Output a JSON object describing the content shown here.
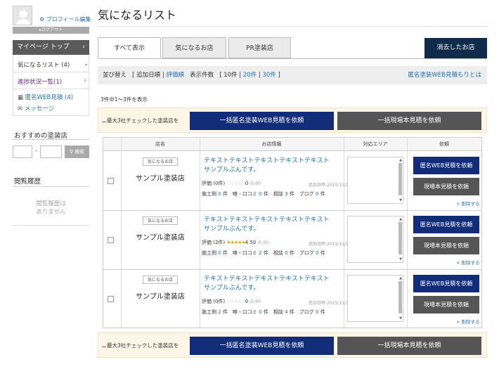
{
  "sidebar": {
    "profile_edit": "プロフィール編集",
    "logout": "ログアウト",
    "mypage_top": "マイページ トップ",
    "chevron": "›",
    "favorites": "気になるリスト (4)",
    "progress": "進捗状況一覧(1)",
    "anon_quote": "匿名WEB見積 (4)",
    "message": "メッセージ",
    "recommend_title": "おすすめの塗装店",
    "search_sep": "-",
    "search_button": "検索",
    "history_title": "閲覧履歴",
    "history_empty_1": "閲覧履歴は",
    "history_empty_2": "ありません"
  },
  "main": {
    "title": "気になるリスト",
    "tabs": [
      {
        "label": "すべて表示"
      },
      {
        "label": "気になるお店"
      },
      {
        "label": "PR塗装店"
      }
    ],
    "deleted_button": "消去したお店",
    "sort": {
      "label": "並び替え",
      "open": "[",
      "close": "]",
      "added": "追加日順",
      "sep": "|",
      "rating": "評価順",
      "count_label": "表示件数",
      "c10": "10件",
      "c20": "20件",
      "c30": "30件",
      "what_is": "匿名塗装WEB見積もりとは"
    },
    "count_text": "3件中1～3件を表示",
    "bulk": {
      "label": "最大3社チェックした塗装店を",
      "anon_button": "一括匿名塗装WEB見積を依頼",
      "site_button": "一括現場本見積を依頼"
    },
    "table": {
      "headers": [
        "店名",
        "お店情報",
        "対応エリア",
        "依頼"
      ],
      "rows": [
        {
          "badge": "気になるお店",
          "shop": "サンプル塗装店",
          "desc1": "テキストテキストテキストテキストテキスト",
          "desc2": "サンプルぶんです。",
          "rating_label": "評価",
          "rating_count": "(0件)",
          "stars": "☆☆☆☆☆",
          "score": "0",
          "score_max": "/5.00",
          "date": "追加日時:2015/11/16",
          "cases_label": "施工例",
          "cases": "0",
          "reviews_label": "件　噂・口コミ",
          "reviews": "0",
          "consult_label": "件　相談",
          "consult": "3",
          "blog_label": "件　ブログ",
          "blog": "0",
          "unit": "件",
          "anon_button": "匿名WEB見積を依頼",
          "site_button": "現場本見積を依頼",
          "delete": "× 削除する"
        },
        {
          "badge": "気になるお店",
          "shop": "サンプル塗装店",
          "desc1": "テキストテキストテキストテキストテキスト",
          "desc2": "サンプルぶんです。",
          "rating_label": "評価",
          "rating_count": "(2件)",
          "stars": "★★★★★",
          "score": "4.50",
          "score_max": "/5.00",
          "date": "追加日時:2015/11/16",
          "cases_label": "施工例",
          "cases": "0",
          "reviews_label": "件　噂・口コミ",
          "reviews": "2",
          "consult_label": "件　相談",
          "consult": "0",
          "blog_label": "件　ブログ",
          "blog": "0",
          "unit": "件",
          "anon_button": "匿名WEB見積を依頼",
          "site_button": "現場本見積を依頼",
          "delete": "× 削除する"
        },
        {
          "badge": "気になるお店",
          "shop": "サンプル塗装店",
          "desc1": "テキストテキストテキストテキストテキスト",
          "desc2": "サンプルぶんです。",
          "rating_label": "評価",
          "rating_count": "(0件)",
          "stars": "☆☆☆☆☆",
          "score": "0",
          "score_max": "/5.00",
          "date": "追加日時:2015/11/16",
          "cases_label": "施工例",
          "cases": "2",
          "reviews_label": "件　噂・口コミ",
          "reviews": "0",
          "consult_label": "件　相談",
          "consult": "4",
          "blog_label": "件　ブログ",
          "blog": "0",
          "unit": "件",
          "anon_button": "匿名WEB見積を依頼",
          "site_button": "現場本見積を依頼",
          "delete": "× 削除する"
        }
      ]
    }
  },
  "icons": {
    "gear": "gear-icon",
    "mail": "mail-icon",
    "calculator": "calculator-icon",
    "search": "search-icon",
    "user": "user-icon",
    "chevron_down": "chevron-down-icon"
  },
  "colors": {
    "primary_navy": "#112d7a",
    "dark_button": "#555555",
    "link": "#1f6fb5",
    "star": "#e2a400",
    "bulk_bg": "#fdf5e6"
  }
}
